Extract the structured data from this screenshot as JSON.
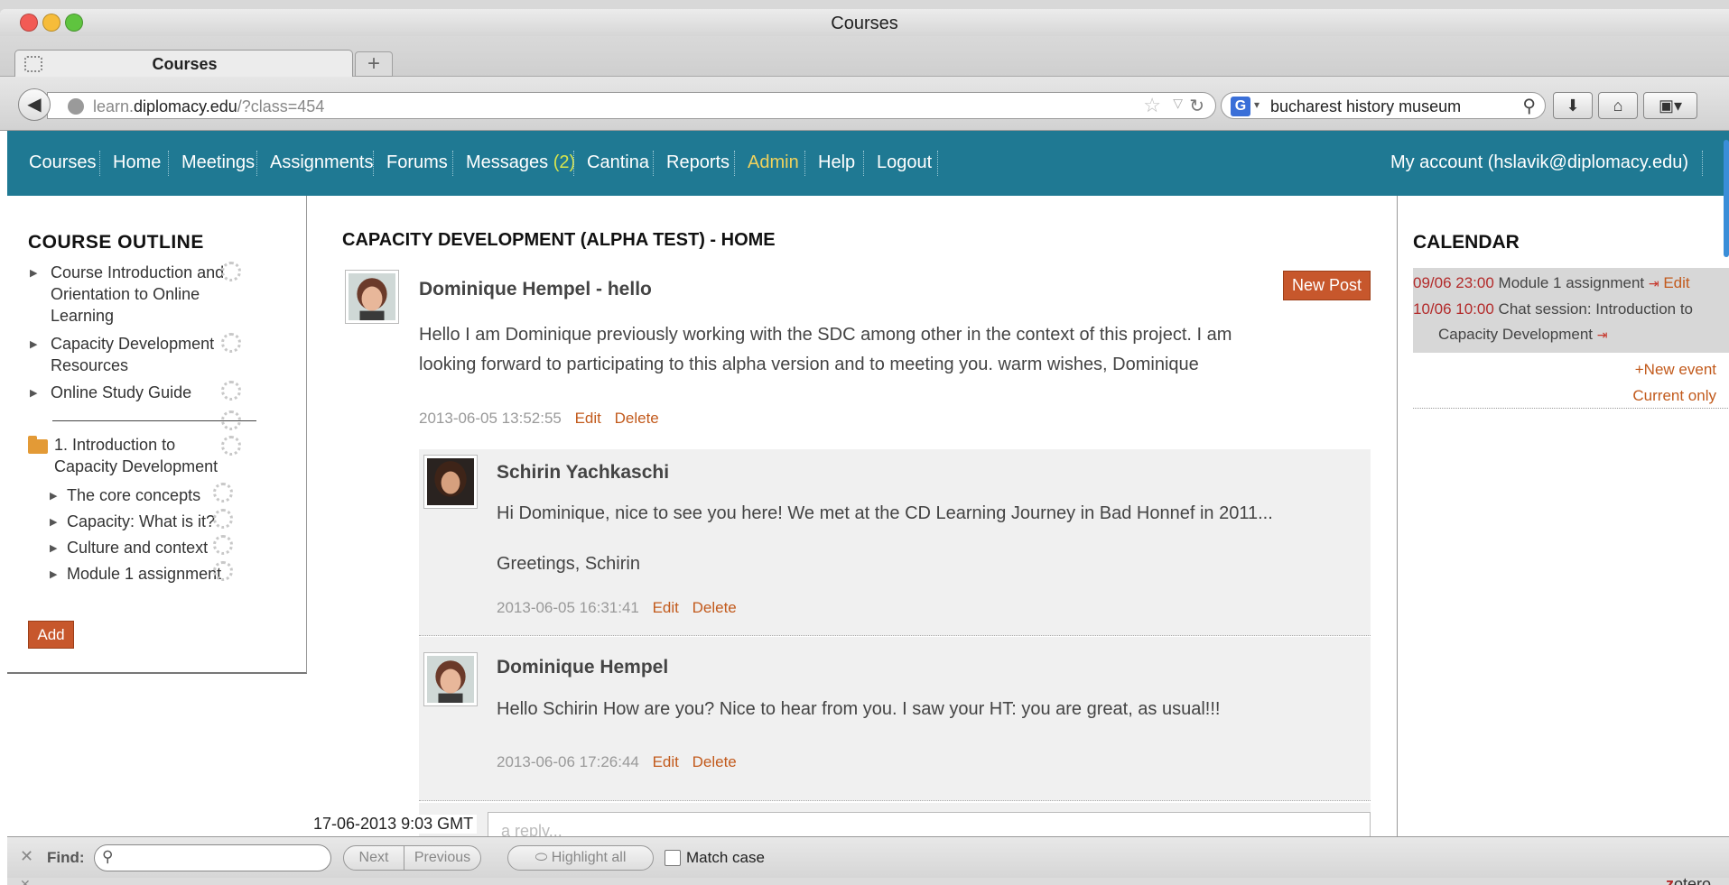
{
  "window": {
    "title": "Courses"
  },
  "tabs": [
    {
      "title": "Courses"
    }
  ],
  "new_tab_label": "+",
  "address": {
    "host_prefix": "learn.",
    "host_main": "diplomacy.edu",
    "path": "/?class=454"
  },
  "search": {
    "engine_icon": "G",
    "query": "bucharest history museum"
  },
  "menu": {
    "items": [
      "Courses",
      "Home",
      "Meetings",
      "Assignments",
      "Forums",
      "Messages",
      "Cantina",
      "Reports",
      "Admin",
      "Help",
      "Logout"
    ],
    "messages_count": "(2)",
    "account": "My account (hslavik@diplomacy.edu)"
  },
  "outline": {
    "title": "COURSE OUTLINE",
    "items": [
      {
        "line1": "Course Introduction and",
        "line2": "Orientation to Online",
        "line3": "Learning"
      },
      {
        "line1": "Capacity Development",
        "line2": "Resources"
      },
      {
        "line1": "Online Study Guide"
      }
    ],
    "module": {
      "line1": "1. Introduction to",
      "line2": "Capacity Development"
    },
    "module_items": [
      "The core concepts",
      "Capacity: What is it?",
      "Culture and context",
      "Module 1 assignment"
    ],
    "add_label": "Add"
  },
  "main": {
    "title": "CAPACITY DEVELOPMENT (ALPHA TEST) - HOME",
    "new_post_label": "New Post",
    "post": {
      "author": "Dominique Hempel - hello",
      "text_line1": "Hello I am Dominique previously working with the SDC among other in the context of this project. I am",
      "text_line2": "looking forward to participating to this alpha version and to meeting you. warm wishes, Dominique",
      "date": "2013-06-05 13:52:55",
      "edit": "Edit",
      "delete": "Delete"
    },
    "replies": [
      {
        "author": "Schirin Yachkaschi",
        "text_line1": "Hi Dominique, nice to see you here! We met at the CD Learning Journey in Bad Honnef in 2011...",
        "text_line2": "Greetings, Schirin",
        "date": "2013-06-05 16:31:41",
        "edit": "Edit",
        "delete": "Delete"
      },
      {
        "author": "Dominique Hempel",
        "text_line1": "Hello Schirin How are you? Nice to hear from you. I saw your HT: you are great, as usual!!!",
        "date": "2013-06-06 17:26:44",
        "edit": "Edit",
        "delete": "Delete"
      }
    ],
    "reply_placeholder": "a reply...",
    "timestamp": "17-06-2013 9:03 GMT"
  },
  "calendar": {
    "title": "CALENDAR",
    "events": [
      {
        "time": "09/06 23:00",
        "text": "Module 1 assignment",
        "edit": "Edit"
      },
      {
        "time": "10/06 10:00",
        "text": "Chat session: Introduction to",
        "text2": "Capacity Development"
      }
    ],
    "new_event": "+New event",
    "current_only": "Current only"
  },
  "findbar": {
    "label": "Find:",
    "next": "Next",
    "previous": "Previous",
    "highlight": "Highlight all",
    "match_case": "Match case"
  },
  "status": {
    "zotero_z": "z",
    "zotero_rest": "otero"
  },
  "colors": {
    "menu_bg": "#1f7993",
    "accent": "#c7572c",
    "admin": "#f0d25c",
    "cal_time": "#b32b2b"
  }
}
